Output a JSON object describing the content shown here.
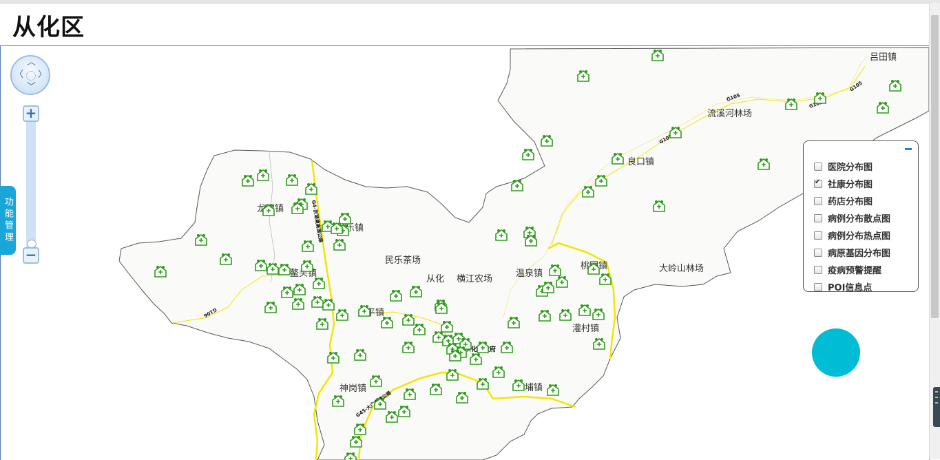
{
  "page": {
    "title": "从化区"
  },
  "controls": {
    "pan_icon": "pan-arrows-icon",
    "zoom_in_label": "+",
    "zoom_out_label": "−",
    "function_tab_label": "功能管理"
  },
  "layer_panel": {
    "collapse_icon": "minus-icon",
    "items": [
      {
        "label": "医院分布图",
        "checked": false
      },
      {
        "label": "社康分布图",
        "checked": true
      },
      {
        "label": "药店分布图",
        "checked": false
      },
      {
        "label": "病例分布散点图",
        "checked": false
      },
      {
        "label": "病例分布热点图",
        "checked": false
      },
      {
        "label": "病原基因分布图",
        "checked": false
      },
      {
        "label": "疫病预警提醒",
        "checked": false
      },
      {
        "label": "POI信息点",
        "checked": false
      }
    ]
  },
  "map": {
    "places": [
      {
        "name": "吕田镇"
      },
      {
        "name": "流溪河林场"
      },
      {
        "name": "良口镇"
      },
      {
        "name": "龙潭镇"
      },
      {
        "name": "吕乐镇"
      },
      {
        "name": "民乐茶场"
      },
      {
        "name": "鳌头镇"
      },
      {
        "name": "从化"
      },
      {
        "name": "横江农场"
      },
      {
        "name": "温泉镇"
      },
      {
        "name": "桃园镇"
      },
      {
        "name": "大岭山林场"
      },
      {
        "name": "太平镇"
      },
      {
        "name": "灌村镇"
      },
      {
        "name": "神岗镇"
      },
      {
        "name": "江埔镇"
      },
      {
        "name": "从化市政府"
      }
    ],
    "roads": [
      {
        "name": "G105"
      },
      {
        "name": "G105"
      },
      {
        "name": "G105"
      },
      {
        "name": "G106"
      },
      {
        "name": "G4-京港澳高速公路"
      },
      {
        "name": "G45-大广高速公路"
      }
    ],
    "marker_icon": "community-health-icon",
    "marker_color": "#2e9b1a",
    "road_color": "#f2e600",
    "boundary_color": "#555555"
  },
  "colors": {
    "accent": "#00bcd4",
    "tab": "#1aa6d8"
  }
}
